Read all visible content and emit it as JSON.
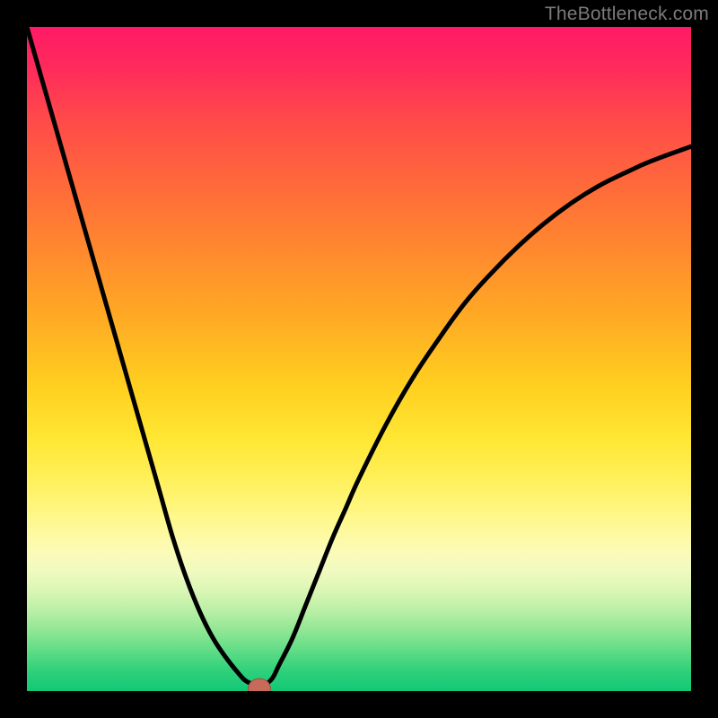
{
  "watermark": {
    "text": "TheBottleneck.com"
  },
  "colors": {
    "curve_stroke": "#000000",
    "marker_fill": "#c86a5a",
    "marker_stroke": "#9a4d40",
    "background": "#000000"
  },
  "chart_data": {
    "type": "line",
    "title": "",
    "xlabel": "",
    "ylabel": "",
    "xlim": [
      0,
      100
    ],
    "ylim": [
      0,
      100
    ],
    "grid": false,
    "x": [
      0,
      2,
      4,
      6,
      8,
      10,
      12,
      14,
      16,
      18,
      20,
      22,
      24,
      26,
      28,
      30,
      32,
      33,
      34,
      35,
      36,
      37,
      38,
      40,
      42,
      44,
      46,
      48,
      50,
      54,
      58,
      62,
      66,
      70,
      74,
      78,
      82,
      86,
      90,
      94,
      100
    ],
    "values": [
      100,
      93,
      86,
      79,
      72,
      65,
      58,
      51,
      44,
      37,
      30,
      23,
      17,
      12,
      8,
      5,
      2.5,
      1.5,
      1,
      0,
      1,
      2,
      4,
      8,
      13,
      18,
      23,
      27.5,
      32,
      40,
      47,
      53,
      58.5,
      63,
      67,
      70.5,
      73.5,
      76,
      78,
      79.8,
      82
    ],
    "marker": {
      "x": 35,
      "y": 0,
      "rx": 1.0,
      "ry": 1.6
    },
    "annotations": []
  }
}
